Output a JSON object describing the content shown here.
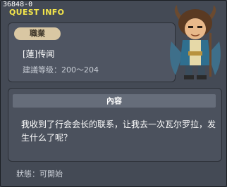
{
  "window": {
    "id": "36848-0",
    "title": "QUEST INFO"
  },
  "quest": {
    "job_badge": "職業",
    "name": "[蓮]传闻",
    "level": "建議等级：200～204"
  },
  "content": {
    "section_title": "內容",
    "description": "我收到了行会会长的联系，让我去一次瓦尔罗拉，发生什么了呢？"
  },
  "footer": {
    "status": "狀態：可開始"
  },
  "colors": {
    "title": "#f4e64b",
    "badge": "#d9c7a3",
    "panel": "#4f5562"
  },
  "icons": {
    "npc": "npc-portrait"
  }
}
